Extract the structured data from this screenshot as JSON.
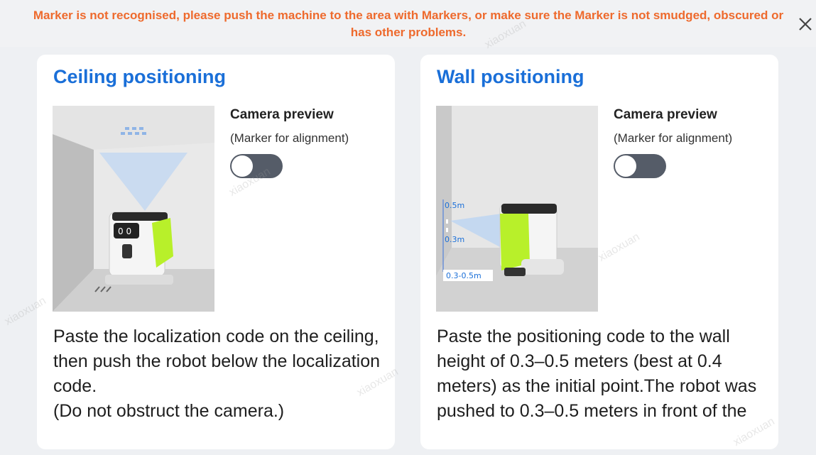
{
  "warning": {
    "text": "Marker is not recognised, please push the machine to the area with Markers, or make sure the Marker is not smudged, obscured or has other problems."
  },
  "close": {
    "icon": "close-icon"
  },
  "cards": [
    {
      "title": "Ceiling positioning",
      "camera_title": "Camera preview",
      "camera_subtitle": "(Marker for alignment)",
      "toggle_on": false,
      "illustration": "ceiling-positioning-illustration",
      "description": "Paste the localization code on the ceiling, then push the robot below the localization code.\n(Do not obstruct the camera.)"
    },
    {
      "title": "Wall positioning",
      "camera_title": "Camera preview",
      "camera_subtitle": "(Marker for alignment)",
      "toggle_on": false,
      "illustration": "wall-positioning-illustration",
      "illustration_labels": [
        "0.5m",
        "0.3m",
        "0.3-0.5m"
      ],
      "description": "Paste the positioning code to the wall height of 0.3–0.5 meters (best at 0.4 meters) as the initial point.The robot was pushed to 0.3–0.5 meters in front of the"
    }
  ],
  "watermark": "xiaoxuan",
  "colors": {
    "warning": "#ee6a2d",
    "title": "#1a6fd8",
    "robot_accent": "#b8f02a",
    "toggle_track": "#555c68"
  }
}
